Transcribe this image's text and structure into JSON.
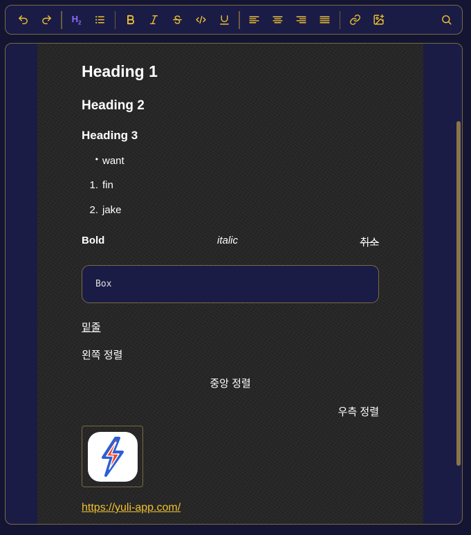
{
  "toolbar": {
    "buttons": [
      {
        "name": "undo-icon"
      },
      {
        "name": "redo-icon"
      },
      {
        "name": "heading-2-icon",
        "label": "H2",
        "active": true
      },
      {
        "name": "bullet-list-icon"
      },
      {
        "name": "bold-icon"
      },
      {
        "name": "italic-icon"
      },
      {
        "name": "strikethrough-icon"
      },
      {
        "name": "code-icon"
      },
      {
        "name": "underline-icon"
      },
      {
        "name": "align-left-icon"
      },
      {
        "name": "align-center-icon"
      },
      {
        "name": "align-right-icon"
      },
      {
        "name": "align-justify-icon"
      },
      {
        "name": "link-icon"
      },
      {
        "name": "add-image-icon"
      },
      {
        "name": "search-icon"
      }
    ],
    "accent_color": "#f1c232",
    "active_color": "#8e6bff"
  },
  "doc": {
    "heading1": "Heading 1",
    "heading2": "Heading 2",
    "heading3": "Heading 3",
    "bullet_item": "want",
    "bullet_mark": "•",
    "ordered": [
      {
        "num": "1.",
        "text": "fin"
      },
      {
        "num": "2.",
        "text": "jake"
      }
    ],
    "bold_text": "Bold",
    "italic_text": "italic",
    "strike_text": "취소",
    "code_box": "Box",
    "underline_text": "밑줄",
    "align_left": "왼쪽 정렬",
    "align_center": "중앙 정렬",
    "align_right": "우측 정렬",
    "image_icon": "yuli-app-logo",
    "link": "https://yuli-app.com/"
  },
  "colors": {
    "background": "#1a1c45",
    "paper": "#262626",
    "border": "#7a6a44",
    "link": "#f1c232"
  }
}
